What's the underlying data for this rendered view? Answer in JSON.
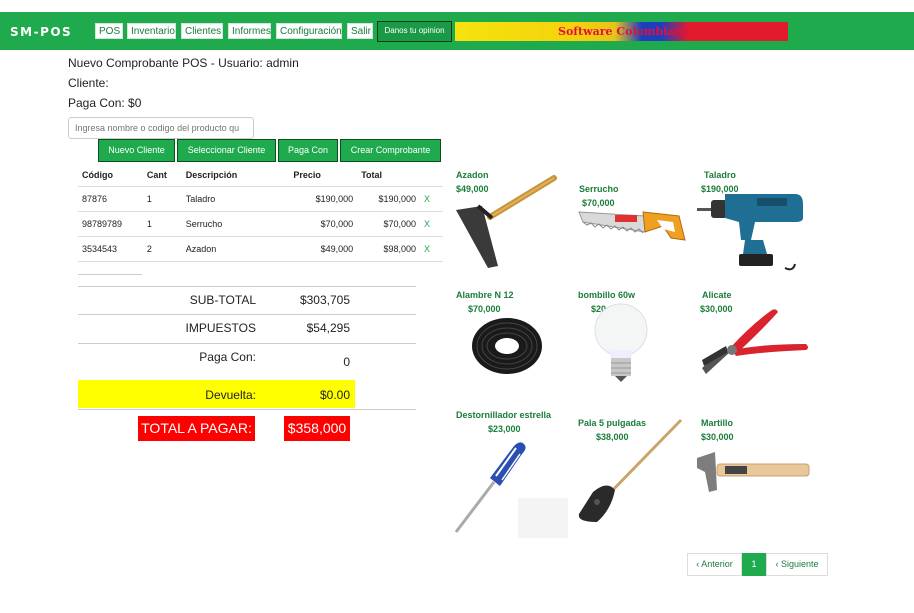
{
  "nav": {
    "brand": "SM-POS",
    "items": [
      "POS",
      "Inventario",
      "Clientes",
      "Informes",
      "Configuración",
      "Salir"
    ],
    "opinion": "Danos tu opinion",
    "banner": "Software Colombiano"
  },
  "header": {
    "title": "Nuevo Comprobante POS - Usuario: admin",
    "cliente": "Cliente:",
    "paga_con": "Paga Con: $0"
  },
  "search": {
    "placeholder": "Ingresa nombre o codigo del producto qu"
  },
  "buttons": {
    "nuevo_cliente": "Nuevo Cliente",
    "seleccionar_cliente": "Seleccionar Cliente",
    "paga_con": "Paga Con",
    "crear": "Crear Comprobante"
  },
  "table": {
    "headers": [
      "Código",
      "Cant",
      "Descripción",
      "Precio",
      "Total"
    ],
    "rows": [
      {
        "codigo": "87876",
        "cant": "1",
        "desc": "Taladro",
        "precio": "$190,000",
        "total": "$190,000",
        "del": "X"
      },
      {
        "codigo": "98789789",
        "cant": "1",
        "desc": "Serrucho",
        "precio": "$70,000",
        "total": "$70,000",
        "del": "X"
      },
      {
        "codigo": "3534543",
        "cant": "2",
        "desc": "Azadon",
        "precio": "$49,000",
        "total": "$98,000",
        "del": "X"
      }
    ]
  },
  "summary": {
    "subtotal_label": "SUB-TOTAL",
    "subtotal": "$303,705",
    "impuestos_label": "IMPUESTOS",
    "impuestos": "$54,295",
    "paga_label": "Paga Con:",
    "paga": "0",
    "devuelta_label": "Devuelta:",
    "devuelta": "$0.00",
    "total_label": "TOTAL A PAGAR:",
    "total": "$358,000"
  },
  "products": [
    {
      "name": "Azadon",
      "price": "$49,000",
      "icon": "hoe-icon"
    },
    {
      "name": "Serrucho",
      "price": "$70,000",
      "icon": "saw-icon"
    },
    {
      "name": "Taladro",
      "price": "$190,000",
      "icon": "drill-icon"
    },
    {
      "name": "Alambre N 12",
      "price": "$70,000",
      "icon": "wire-coil-icon"
    },
    {
      "name": "bombillo 60w",
      "price": "$20,000",
      "icon": "light-bulb-icon"
    },
    {
      "name": "Alicate",
      "price": "$30,000",
      "icon": "pliers-icon"
    },
    {
      "name": "Destornillador estrella",
      "price": "$23,000",
      "icon": "screwdriver-icon"
    },
    {
      "name": "Pala 5 pulgadas",
      "price": "$38,000",
      "icon": "shovel-icon"
    },
    {
      "name": "Martillo",
      "price": "$30,000",
      "icon": "hammer-icon"
    }
  ],
  "pagination": {
    "prev": "‹ Anterior",
    "page": "1",
    "next": "‹ Siguiente"
  },
  "colors": {
    "accent": "#1faa4e",
    "highlight": "#ffff00",
    "total_bg": "#ff0000"
  }
}
